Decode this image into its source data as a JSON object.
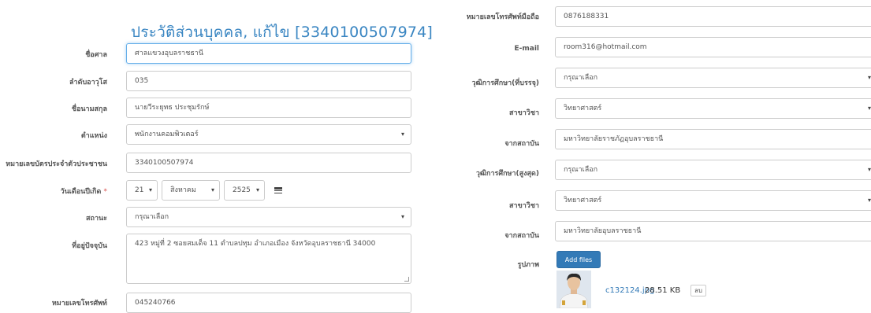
{
  "form_title": "ประวัติส่วนบุคคล, แก้ไข [3340100507974]",
  "left": {
    "court": {
      "label": "ชื่อศาล",
      "value": "ศาลแขวงอุบลราชธานี"
    },
    "order_no": {
      "label": "ลำดับอาวุโส",
      "value": "035"
    },
    "fullname": {
      "label": "ชื่อนามสกุล",
      "value": "นายวีระยุทธ ประชุมรักษ์"
    },
    "position": {
      "label": "ตำแหน่ง",
      "value": "พนักงานคอมพิวเตอร์"
    },
    "citizen_id": {
      "label": "หมายเลขบัตรประจำตัวประชาชน",
      "value": "3340100507974"
    },
    "birthdate": {
      "label": "วันเดือนปีเกิด",
      "required_mark": "*",
      "day": "21",
      "month": "สิงหาคม",
      "year": "2525"
    },
    "status": {
      "label": "สถานะ",
      "value": "กรุณาเลือก"
    },
    "address": {
      "label": "ที่อยู่ปัจจุบัน",
      "value": "423 หมู่ที่ 2 ซอยสมเด็จ 11 ตำบลปทุม อำเภอเมือง จังหวัดอุบลราชธานี 34000"
    },
    "phone": {
      "label": "หมายเลขโทรศัพท์",
      "value": "045240766"
    }
  },
  "right": {
    "mobile": {
      "label": "หมายเลขโทรศัพท์มือถือ",
      "value": "0876188331"
    },
    "email": {
      "label": "E-mail",
      "value": "room316@hotmail.com"
    },
    "edu_entry": {
      "label": "วุฒิการศึกษา(ที่บรรจุ)",
      "value": "กรุณาเลือก"
    },
    "major1": {
      "label": "สาขาวิชา",
      "value": "วิทยาศาสตร์"
    },
    "inst1": {
      "label": "จากสถาบัน",
      "value": "มหาวิทยาลัยราชภัฏอุบลราชธานี"
    },
    "edu_high": {
      "label": "วุฒิการศึกษา(สูงสุด)",
      "value": "กรุณาเลือก"
    },
    "major2": {
      "label": "สาขาวิชา",
      "value": "วิทยาศาสตร์"
    },
    "inst2": {
      "label": "จากสถาบัน",
      "value": "มหาวิทยาลัยอุบลราชธานี"
    },
    "photo": {
      "label": "รูปภาพ",
      "add_label": "Add files",
      "file_name": "c132124.jpg",
      "file_size": "28.51 KB",
      "delete_label": "ลบ"
    }
  },
  "icons": {
    "calendar": "calendar-icon",
    "dropdown": "chevron-down-icon"
  },
  "colors": {
    "title": "#3a86c2",
    "primary_button": "#337ab7",
    "required": "#d9534f"
  }
}
